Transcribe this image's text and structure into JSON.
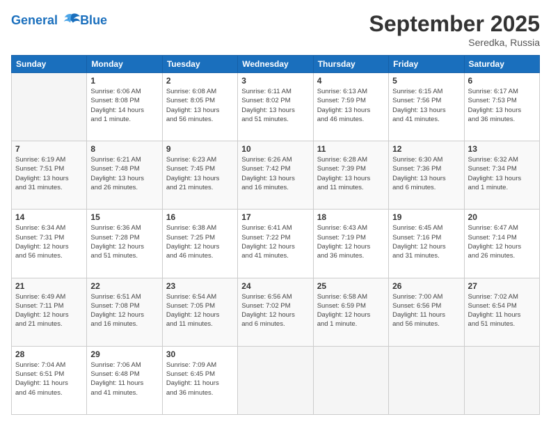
{
  "header": {
    "logo_line1": "General",
    "logo_line2": "Blue",
    "month": "September 2025",
    "location": "Seredka, Russia"
  },
  "weekdays": [
    "Sunday",
    "Monday",
    "Tuesday",
    "Wednesday",
    "Thursday",
    "Friday",
    "Saturday"
  ],
  "weeks": [
    [
      {
        "day": "",
        "info": ""
      },
      {
        "day": "1",
        "info": "Sunrise: 6:06 AM\nSunset: 8:08 PM\nDaylight: 14 hours\nand 1 minute."
      },
      {
        "day": "2",
        "info": "Sunrise: 6:08 AM\nSunset: 8:05 PM\nDaylight: 13 hours\nand 56 minutes."
      },
      {
        "day": "3",
        "info": "Sunrise: 6:11 AM\nSunset: 8:02 PM\nDaylight: 13 hours\nand 51 minutes."
      },
      {
        "day": "4",
        "info": "Sunrise: 6:13 AM\nSunset: 7:59 PM\nDaylight: 13 hours\nand 46 minutes."
      },
      {
        "day": "5",
        "info": "Sunrise: 6:15 AM\nSunset: 7:56 PM\nDaylight: 13 hours\nand 41 minutes."
      },
      {
        "day": "6",
        "info": "Sunrise: 6:17 AM\nSunset: 7:53 PM\nDaylight: 13 hours\nand 36 minutes."
      }
    ],
    [
      {
        "day": "7",
        "info": "Sunrise: 6:19 AM\nSunset: 7:51 PM\nDaylight: 13 hours\nand 31 minutes."
      },
      {
        "day": "8",
        "info": "Sunrise: 6:21 AM\nSunset: 7:48 PM\nDaylight: 13 hours\nand 26 minutes."
      },
      {
        "day": "9",
        "info": "Sunrise: 6:23 AM\nSunset: 7:45 PM\nDaylight: 13 hours\nand 21 minutes."
      },
      {
        "day": "10",
        "info": "Sunrise: 6:26 AM\nSunset: 7:42 PM\nDaylight: 13 hours\nand 16 minutes."
      },
      {
        "day": "11",
        "info": "Sunrise: 6:28 AM\nSunset: 7:39 PM\nDaylight: 13 hours\nand 11 minutes."
      },
      {
        "day": "12",
        "info": "Sunrise: 6:30 AM\nSunset: 7:36 PM\nDaylight: 13 hours\nand 6 minutes."
      },
      {
        "day": "13",
        "info": "Sunrise: 6:32 AM\nSunset: 7:34 PM\nDaylight: 13 hours\nand 1 minute."
      }
    ],
    [
      {
        "day": "14",
        "info": "Sunrise: 6:34 AM\nSunset: 7:31 PM\nDaylight: 12 hours\nand 56 minutes."
      },
      {
        "day": "15",
        "info": "Sunrise: 6:36 AM\nSunset: 7:28 PM\nDaylight: 12 hours\nand 51 minutes."
      },
      {
        "day": "16",
        "info": "Sunrise: 6:38 AM\nSunset: 7:25 PM\nDaylight: 12 hours\nand 46 minutes."
      },
      {
        "day": "17",
        "info": "Sunrise: 6:41 AM\nSunset: 7:22 PM\nDaylight: 12 hours\nand 41 minutes."
      },
      {
        "day": "18",
        "info": "Sunrise: 6:43 AM\nSunset: 7:19 PM\nDaylight: 12 hours\nand 36 minutes."
      },
      {
        "day": "19",
        "info": "Sunrise: 6:45 AM\nSunset: 7:16 PM\nDaylight: 12 hours\nand 31 minutes."
      },
      {
        "day": "20",
        "info": "Sunrise: 6:47 AM\nSunset: 7:14 PM\nDaylight: 12 hours\nand 26 minutes."
      }
    ],
    [
      {
        "day": "21",
        "info": "Sunrise: 6:49 AM\nSunset: 7:11 PM\nDaylight: 12 hours\nand 21 minutes."
      },
      {
        "day": "22",
        "info": "Sunrise: 6:51 AM\nSunset: 7:08 PM\nDaylight: 12 hours\nand 16 minutes."
      },
      {
        "day": "23",
        "info": "Sunrise: 6:54 AM\nSunset: 7:05 PM\nDaylight: 12 hours\nand 11 minutes."
      },
      {
        "day": "24",
        "info": "Sunrise: 6:56 AM\nSunset: 7:02 PM\nDaylight: 12 hours\nand 6 minutes."
      },
      {
        "day": "25",
        "info": "Sunrise: 6:58 AM\nSunset: 6:59 PM\nDaylight: 12 hours\nand 1 minute."
      },
      {
        "day": "26",
        "info": "Sunrise: 7:00 AM\nSunset: 6:56 PM\nDaylight: 11 hours\nand 56 minutes."
      },
      {
        "day": "27",
        "info": "Sunrise: 7:02 AM\nSunset: 6:54 PM\nDaylight: 11 hours\nand 51 minutes."
      }
    ],
    [
      {
        "day": "28",
        "info": "Sunrise: 7:04 AM\nSunset: 6:51 PM\nDaylight: 11 hours\nand 46 minutes."
      },
      {
        "day": "29",
        "info": "Sunrise: 7:06 AM\nSunset: 6:48 PM\nDaylight: 11 hours\nand 41 minutes."
      },
      {
        "day": "30",
        "info": "Sunrise: 7:09 AM\nSunset: 6:45 PM\nDaylight: 11 hours\nand 36 minutes."
      },
      {
        "day": "",
        "info": ""
      },
      {
        "day": "",
        "info": ""
      },
      {
        "day": "",
        "info": ""
      },
      {
        "day": "",
        "info": ""
      }
    ]
  ]
}
